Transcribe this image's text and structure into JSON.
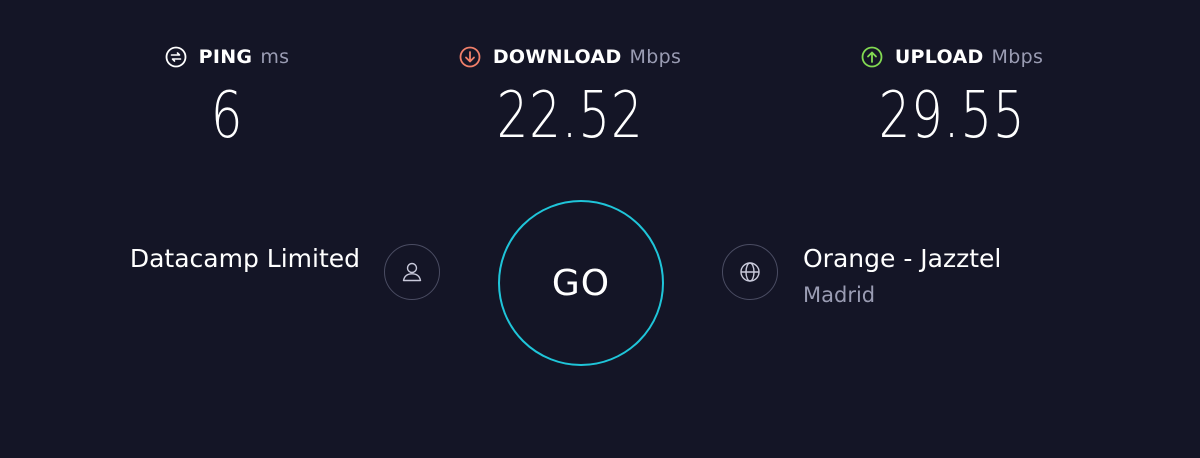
{
  "metrics": {
    "ping": {
      "label": "PING",
      "unit": "ms",
      "value": "6",
      "icon": "ping-icon",
      "icon_color": "#ffffff"
    },
    "download": {
      "label": "DOWNLOAD",
      "unit": "Mbps",
      "value": "22.52",
      "icon": "download-arrow-icon",
      "icon_color": "#f17f6a"
    },
    "upload": {
      "label": "UPLOAD",
      "unit": "Mbps",
      "value": "29.55",
      "icon": "upload-arrow-icon",
      "icon_color": "#82d952"
    }
  },
  "isp": {
    "name": "Datacamp Limited",
    "icon": "user-icon"
  },
  "go_button": {
    "label": "GO",
    "ring_color": "#1fc5d9"
  },
  "server": {
    "name": "Orange - Jazztel",
    "location": "Madrid",
    "icon": "globe-icon"
  },
  "colors": {
    "background": "#141526",
    "muted_text": "#9a9cb3",
    "icon_ring": "#4a4c62"
  }
}
